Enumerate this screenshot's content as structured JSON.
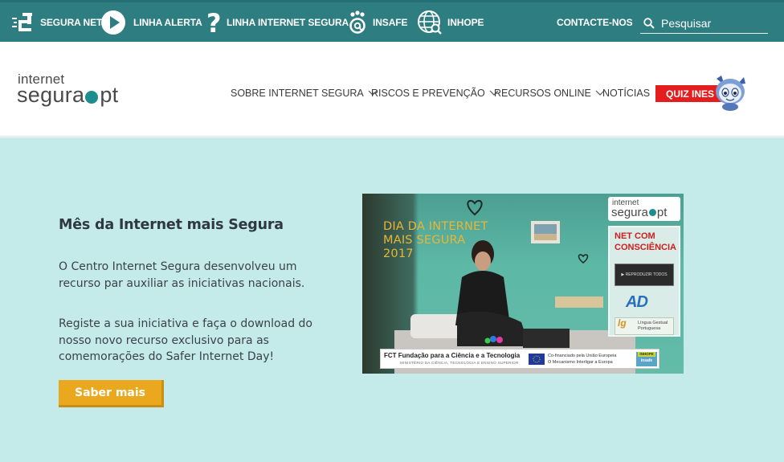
{
  "topbar": {
    "items": [
      {
        "label": "SEGURA NET",
        "icon": "segura-net-icon"
      },
      {
        "label": "LINHA ALERTA",
        "icon": "play-circle-icon"
      },
      {
        "label": "LINHA INTERNET SEGURA",
        "icon": "question-mark-icon"
      },
      {
        "label": "INSAFE",
        "icon": "insafe-paw-icon"
      },
      {
        "label": "INHOPE",
        "icon": "globe-search-icon"
      }
    ],
    "contact_label": "CONTACTE-NOS",
    "search": {
      "placeholder": "Pesquisar",
      "value": ""
    }
  },
  "header": {
    "logo": {
      "line1": "internet",
      "line2_left": "segura",
      "line2_right": "pt"
    },
    "nav": [
      {
        "label": "SOBRE INTERNET SEGURA",
        "has_dropdown": true
      },
      {
        "label": "RISCOS E PREVENÇÃO",
        "has_dropdown": true
      },
      {
        "label": "RECURSOS ONLINE",
        "has_dropdown": true
      },
      {
        "label": "NOTÍCIAS",
        "has_dropdown": false
      }
    ],
    "quiz_label": "QUIZ INES"
  },
  "hero": {
    "title": "Mês da Internet mais Segura",
    "paragraph1": "O Centro Internet Segura desenvolveu um recurso par auxiliar as iniciativas nacionais.",
    "paragraph2": "Registe a sua iniciativa e faça o download do nosso novo recurso exclusivo para as comemorações do Safer Internet Day!",
    "cta_label": "Saber mais",
    "image": {
      "title_line1": "DIA DA INTERNET",
      "title_line2": "MAIS SEGURA",
      "title_line3": "2017",
      "logo_line1": "internet",
      "logo_line2_left": "segura",
      "logo_line2_right": "pt",
      "panel_title_line1": "NET COM",
      "panel_title_line2": "CONSCIÊNCIA",
      "play_text": "▶ REPRODUZIR TODOS",
      "ad_mark": "AD",
      "lg_mark": "lg",
      "lg_line1": "Língua Gestual",
      "lg_line2": "Portuguesa",
      "fct_name": "FCT Fundação para a Ciência e a Tecnologia",
      "fct_sub": "MINISTÉRIO DA CIÊNCIA, TECNOLOGIA E ENSINO SUPERIOR",
      "eu_line1": "Co-financiado pela União Europeia",
      "eu_line2": "O Mecanismo Interligar a Europa",
      "inhope_line1": "INHOPE",
      "inhope_line2": "insafe"
    }
  },
  "colors": {
    "topbar_bg": "#2e7d80",
    "hero_bg": "#c4eaea",
    "quiz_red": "#e41e1e",
    "cta_orange": "#eaa81f",
    "logo_teal_dot": "#1e8d8d"
  }
}
